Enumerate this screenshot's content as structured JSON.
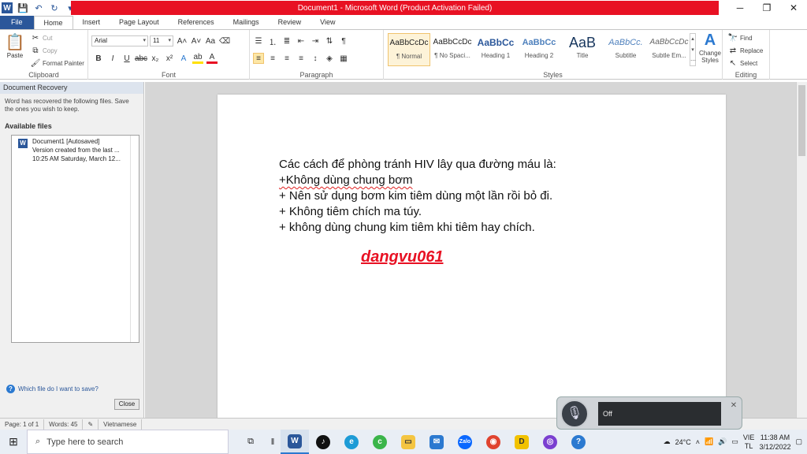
{
  "window": {
    "title": "Document1 - Microsoft Word (Product Activation Failed)",
    "controls": [
      "─",
      "❐",
      "✕"
    ]
  },
  "tabs": [
    "File",
    "Home",
    "Insert",
    "Page Layout",
    "References",
    "Mailings",
    "Review",
    "View"
  ],
  "ribbon": {
    "clipboard": {
      "paste": "Paste",
      "cut": "Cut",
      "copy": "Copy",
      "format_painter": "Format Painter",
      "label": "Clipboard"
    },
    "font": {
      "name": "Arial",
      "size": "11",
      "label": "Font"
    },
    "paragraph": {
      "label": "Paragraph"
    },
    "styles": {
      "items": [
        {
          "sample": "AaBbCcDc",
          "name": "¶ Normal"
        },
        {
          "sample": "AaBbCcDc",
          "name": "¶ No Spaci..."
        },
        {
          "sample": "AaBbCc",
          "name": "Heading 1"
        },
        {
          "sample": "AaBbCc",
          "name": "Heading 2"
        },
        {
          "sample": "AaB",
          "name": "Title"
        },
        {
          "sample": "AaBbCc.",
          "name": "Subtitle"
        },
        {
          "sample": "AaBbCcDc",
          "name": "Subtle Em..."
        }
      ],
      "change_styles": "Change Styles",
      "label": "Styles"
    },
    "editing": {
      "find": "Find",
      "replace": "Replace",
      "select": "Select",
      "label": "Editing"
    }
  },
  "recovery": {
    "title": "Document Recovery",
    "description": "Word has recovered the following files.  Save the ones you wish to keep.",
    "available_label": "Available files",
    "file": {
      "name": "Document1  [Autosaved]",
      "line2": "Version created from the last ...",
      "line3": "10:25 AM Saturday, March 12..."
    },
    "help_link": "Which file do I want to save?",
    "close_button": "Close"
  },
  "document": {
    "lines": [
      "Các cách để phòng tránh HIV lây qua đường máu là:",
      "+Không dùng chung bơm",
      "+ Nên sử dụng bơm kim tiêm dùng một lần rồi bỏ đi.",
      "+ Không tiêm chích ma túy.",
      "+ không dùng chung kim tiêm khi tiêm hay chích."
    ],
    "signature": "dangvu061"
  },
  "status": {
    "page": "Page: 1 of 1",
    "words": "Words: 45",
    "language": "Vietnamese"
  },
  "voice": {
    "state": "Off"
  },
  "taskbar": {
    "search_placeholder": "Type here to search",
    "weather": "24°C",
    "lang_top": "VIE",
    "lang_bottom": "TL",
    "time": "11:38 AM",
    "date": "3/12/2022"
  }
}
